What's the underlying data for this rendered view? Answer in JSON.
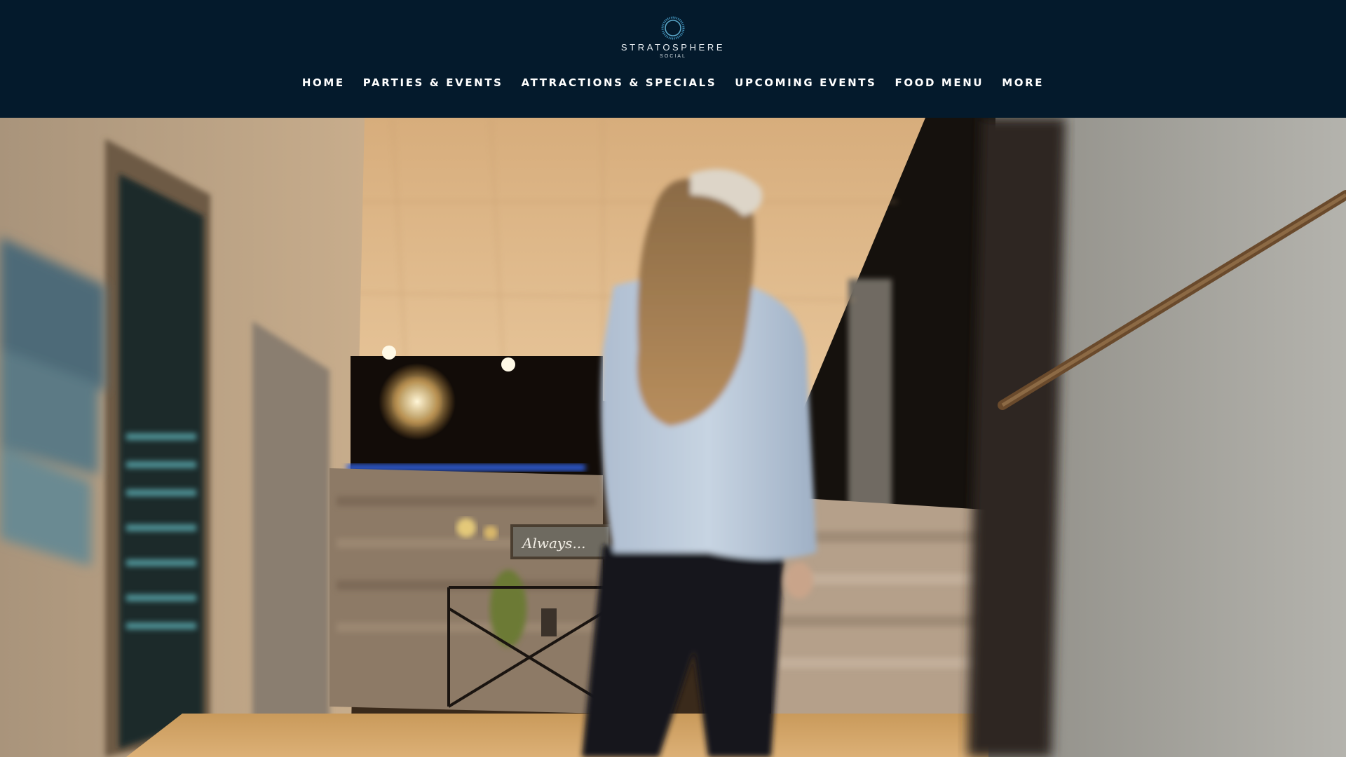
{
  "brand": {
    "name": "STRATOSPHERE",
    "tagline": "SOCIAL"
  },
  "nav": {
    "items": [
      {
        "label": "Home"
      },
      {
        "label": "Parties & Events"
      },
      {
        "label": "Attractions & Specials"
      },
      {
        "label": "Upcoming Events"
      },
      {
        "label": "Food Menu"
      },
      {
        "label": "More"
      }
    ]
  },
  "hero": {
    "sign_text": "Always..."
  },
  "colors": {
    "header_bg": "#041a2c",
    "nav_text": "#ffffff",
    "logo_accent": "#5aa6c8"
  }
}
